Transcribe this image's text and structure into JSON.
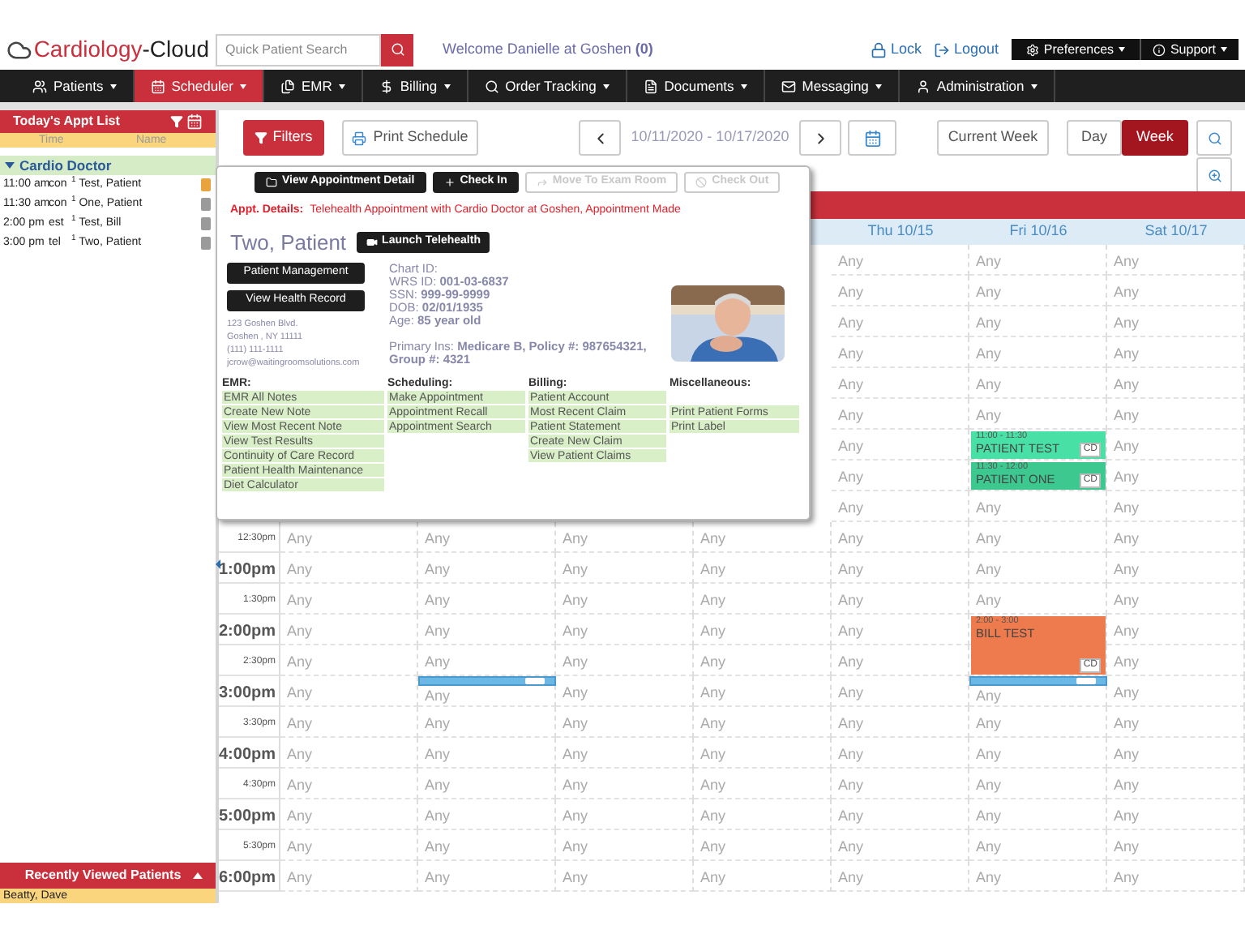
{
  "header": {
    "logo": {
      "brand": "Cardiology",
      "suffix": "-Cloud"
    },
    "search": {
      "placeholder": "Quick Patient Search"
    },
    "welcome": "Welcome Danielle at Goshen **(0)**",
    "links": [
      "Lock",
      "Logout"
    ],
    "menus": [
      "Preferences",
      "Support"
    ]
  },
  "nav": [
    {
      "label": "Patients",
      "selected": false
    },
    {
      "label": "Scheduler",
      "selected": true
    },
    {
      "label": "EMR",
      "selected": false
    },
    {
      "label": "Billing",
      "selected": false
    },
    {
      "label": "Order Tracking",
      "selected": false
    },
    {
      "label": "Documents",
      "selected": false
    },
    {
      "label": "Messaging",
      "selected": false
    },
    {
      "label": "Administration",
      "selected": false
    }
  ],
  "appt_list": {
    "title": "Today's Appt List",
    "columns": [
      "Time",
      "Name"
    ],
    "group": "Cardio Doctor",
    "expanded": true,
    "rows": [
      {
        "time": "11:00 am",
        "type": "con",
        "name": "$^{1}$ Test, Patient",
        "color": "#e8a33c"
      },
      {
        "time": "11:30 am",
        "type": "con",
        "name": "$^{1}$ One, Patient",
        "color": "#9a9a9a"
      },
      {
        "time": "2:00 pm",
        "type": "est",
        "name": "$^{1}$ Test, Bill",
        "color": "#9a9a9a"
      },
      {
        "time": "3:00 pm",
        "type": "tel",
        "name": "$^{1}$ Two, Patient",
        "color": "#9a9a9a"
      }
    ]
  },
  "recent": {
    "title": "Recently Viewed Patients",
    "items": [
      "Beatty, Dave"
    ]
  },
  "toolbar": {
    "filters": "Filters",
    "print": "Print Schedule",
    "range": "10/11/2020 - 10/17/2020",
    "current": "Current Week",
    "views": [
      {
        "label": "Day",
        "selected": false
      },
      {
        "label": "Week",
        "selected": true
      }
    ]
  },
  "calendar": {
    "days": [
      "Thu 10/15",
      "Fri 10/16",
      "Sat 10/17"
    ],
    "rows": [
      {
        "cells": [
          {
            "kind": "slot",
            "text": "Any"
          },
          {
            "kind": "slot",
            "text": "Any"
          },
          {
            "kind": "slot",
            "text": "Any"
          }
        ]
      },
      {
        "cells": [
          {
            "kind": "slot",
            "text": "Any"
          },
          {
            "kind": "slot",
            "text": "Any"
          },
          {
            "kind": "slot",
            "text": "Any"
          }
        ]
      },
      {
        "cells": [
          {
            "kind": "slot",
            "text": "Any"
          },
          {
            "kind": "slot",
            "text": "Any"
          },
          {
            "kind": "slot",
            "text": "Any"
          }
        ]
      },
      {
        "cells": [
          {
            "kind": "slot",
            "text": "Any"
          },
          {
            "kind": "slot",
            "text": "Any"
          },
          {
            "kind": "slot",
            "text": "Any"
          }
        ]
      },
      {
        "cells": [
          {
            "kind": "slot",
            "text": "Any"
          },
          {
            "kind": "slot",
            "text": "Any"
          },
          {
            "kind": "slot",
            "text": "Any"
          }
        ]
      },
      {
        "cells": [
          {
            "kind": "slot",
            "text": "Any"
          },
          {
            "kind": "slot",
            "text": "Any"
          },
          {
            "kind": "slot",
            "text": "Any"
          }
        ]
      },
      {
        "cells": [
          {
            "kind": "slot",
            "text": "Any"
          },
          {
            "kind": "event",
            "time": "11:00 - 11:30",
            "title": "PATIENT TEST",
            "badge": "CD",
            "color": "#48e0a4"
          },
          {
            "kind": "slot",
            "text": "Any"
          }
        ]
      },
      {
        "cells": [
          {
            "kind": "slot",
            "text": "Any"
          },
          {
            "kind": "event",
            "time": "11:30 - 12:00",
            "title": "PATIENT ONE",
            "badge": "CD",
            "color": "#3cc88e"
          },
          {
            "kind": "slot",
            "text": "Any"
          }
        ]
      },
      {
        "cells": [
          {
            "kind": "slot",
            "text": "Any"
          },
          {
            "kind": "slot",
            "text": "Any"
          },
          {
            "kind": "slot",
            "text": "Any"
          }
        ]
      },
      {
        "time": "12:30pm",
        "kind": "half",
        "cells": [
          {
            "kind": "slot",
            "text": "Any"
          },
          {
            "kind": "slot",
            "text": "Any"
          },
          {
            "kind": "slot",
            "text": "Any"
          },
          {
            "kind": "slot",
            "text": "Any"
          },
          {
            "kind": "slot",
            "text": "Any"
          },
          {
            "kind": "slot",
            "text": "Any"
          },
          {
            "kind": "slot",
            "text": "Any"
          }
        ]
      },
      {
        "time": "1:00pm",
        "kind": "hour",
        "cells": [
          {
            "kind": "slot",
            "text": "Any"
          },
          {
            "kind": "slot",
            "text": "Any"
          },
          {
            "kind": "slot",
            "text": "Any"
          },
          {
            "kind": "slot",
            "text": "Any"
          },
          {
            "kind": "slot",
            "text": "Any"
          },
          {
            "kind": "slot",
            "text": "Any"
          },
          {
            "kind": "slot",
            "text": "Any"
          }
        ]
      },
      {
        "time": "1:30pm",
        "kind": "half",
        "cells": [
          {
            "kind": "slot",
            "text": "Any"
          },
          {
            "kind": "slot",
            "text": "Any"
          },
          {
            "kind": "slot",
            "text": "Any"
          },
          {
            "kind": "slot",
            "text": "Any"
          },
          {
            "kind": "slot",
            "text": "Any"
          },
          {
            "kind": "slot",
            "text": "Any"
          },
          {
            "kind": "slot",
            "text": "Any"
          }
        ]
      },
      {
        "time": "2:00pm",
        "kind": "hour",
        "cells": [
          {
            "kind": "slot",
            "text": "Any"
          },
          {
            "kind": "slot",
            "text": "Any"
          },
          {
            "kind": "slot",
            "text": "Any"
          },
          {
            "kind": "slot",
            "text": "Any"
          },
          {
            "kind": "slot",
            "text": "Any"
          },
          {
            "kind": "event_start",
            "time": "2:00 - 3:00",
            "title": "BILL TEST",
            "color": "#ee7b4d"
          },
          {
            "kind": "slot",
            "text": "Any"
          }
        ]
      },
      {
        "time": "2:30pm",
        "kind": "half",
        "cells": [
          {
            "kind": "slot",
            "text": "Any"
          },
          {
            "kind": "slot",
            "text": "Any"
          },
          {
            "kind": "slot",
            "text": "Any"
          },
          {
            "kind": "slot",
            "text": "Any"
          },
          {
            "kind": "slot",
            "text": "Any"
          },
          {
            "kind": "event_end",
            "badge": "CD",
            "color": "#ee7b4d"
          },
          {
            "kind": "slot",
            "text": "Any"
          }
        ]
      },
      {
        "time": "3:00pm",
        "kind": "hour",
        "cells": [
          {
            "kind": "slot",
            "text": "Any"
          },
          {
            "kind": "slot_bar",
            "text": "Any"
          },
          {
            "kind": "slot",
            "text": "Any"
          },
          {
            "kind": "slot",
            "text": "Any"
          },
          {
            "kind": "slot",
            "text": "Any"
          },
          {
            "kind": "slot_bar",
            "text": "Any"
          },
          {
            "kind": "slot",
            "text": "Any"
          }
        ]
      },
      {
        "time": "3:30pm",
        "kind": "half",
        "cells": [
          {
            "kind": "slot",
            "text": "Any"
          },
          {
            "kind": "slot",
            "text": "Any"
          },
          {
            "kind": "slot",
            "text": "Any"
          },
          {
            "kind": "slot",
            "text": "Any"
          },
          {
            "kind": "slot",
            "text": "Any"
          },
          {
            "kind": "slot",
            "text": "Any"
          },
          {
            "kind": "slot",
            "text": "Any"
          }
        ]
      },
      {
        "time": "4:00pm",
        "kind": "hour",
        "cells": [
          {
            "kind": "slot",
            "text": "Any"
          },
          {
            "kind": "slot",
            "text": "Any"
          },
          {
            "kind": "slot",
            "text": "Any"
          },
          {
            "kind": "slot",
            "text": "Any"
          },
          {
            "kind": "slot",
            "text": "Any"
          },
          {
            "kind": "slot",
            "text": "Any"
          },
          {
            "kind": "slot",
            "text": "Any"
          }
        ]
      },
      {
        "time": "4:30pm",
        "kind": "half",
        "cells": [
          {
            "kind": "slot",
            "text": "Any"
          },
          {
            "kind": "slot",
            "text": "Any"
          },
          {
            "kind": "slot",
            "text": "Any"
          },
          {
            "kind": "slot",
            "text": "Any"
          },
          {
            "kind": "slot",
            "text": "Any"
          },
          {
            "kind": "slot",
            "text": "Any"
          },
          {
            "kind": "slot",
            "text": "Any"
          }
        ]
      },
      {
        "time": "5:00pm",
        "kind": "hour",
        "cells": [
          {
            "kind": "slot",
            "text": "Any"
          },
          {
            "kind": "slot",
            "text": "Any"
          },
          {
            "kind": "slot",
            "text": "Any"
          },
          {
            "kind": "slot",
            "text": "Any"
          },
          {
            "kind": "slot",
            "text": "Any"
          },
          {
            "kind": "slot",
            "text": "Any"
          },
          {
            "kind": "slot",
            "text": "Any"
          }
        ]
      },
      {
        "time": "5:30pm",
        "kind": "half",
        "cells": [
          {
            "kind": "slot",
            "text": "Any"
          },
          {
            "kind": "slot",
            "text": "Any"
          },
          {
            "kind": "slot",
            "text": "Any"
          },
          {
            "kind": "slot",
            "text": "Any"
          },
          {
            "kind": "slot",
            "text": "Any"
          },
          {
            "kind": "slot",
            "text": "Any"
          },
          {
            "kind": "slot",
            "text": "Any"
          }
        ]
      },
      {
        "time": "6:00pm",
        "kind": "hour",
        "cells": [
          {
            "kind": "slot",
            "text": "Any"
          },
          {
            "kind": "slot",
            "text": "Any"
          },
          {
            "kind": "slot",
            "text": "Any"
          },
          {
            "kind": "slot",
            "text": "Any"
          },
          {
            "kind": "slot",
            "text": "Any"
          },
          {
            "kind": "slot",
            "text": "Any"
          },
          {
            "kind": "slot",
            "text": "Any"
          }
        ]
      }
    ]
  },
  "popup": {
    "actions": [
      {
        "label": "View Appointment Detail",
        "disabled": false
      },
      {
        "label": "Check In",
        "disabled": false
      },
      {
        "label": "Move To Exam Room",
        "disabled": true
      },
      {
        "label": "Check Out",
        "disabled": true
      }
    ],
    "details_label": "Appt. Details:",
    "details": "Telehealth Appointment with Cardio Doctor at Goshen, Appointment Made",
    "patient": "Two, Patient",
    "telehealth": "Launch Telehealth",
    "buttons": [
      "Patient Management",
      "View Health Record"
    ],
    "address": [
      "123 Goshen Blvd.",
      "Goshen , NY 11111",
      "(111) 111-1111",
      "jcrow@waitingroomsolutions.com"
    ],
    "chart": [
      "Chart ID:",
      "WRS ID: **001-03-6837**",
      "SSN: **999-99-9999**",
      "DOB: **02/01/1935**",
      "Age: **85 year old**"
    ],
    "insurance": "Primary Ins: **Medicare B, Policy #: 987654321, Group #: 4321**",
    "menus": [
      {
        "title": "EMR:",
        "items": [
          "EMR All Notes",
          "Create New Note",
          "View Most Recent Note",
          "View Test Results",
          "Continuity of Care Record",
          "Patient Health Maintenance",
          "Diet Calculator"
        ]
      },
      {
        "title": "Scheduling:",
        "items": [
          "Make Appointment",
          "Appointment Recall",
          "Appointment Search"
        ]
      },
      {
        "title": "Billing:",
        "items": [
          "Patient Account",
          "Most Recent Claim",
          "Patient Statement",
          "Create New Claim",
          "View Patient Claims"
        ]
      },
      {
        "title": "Miscellaneous:",
        "items": [
          "Print Patient Forms",
          "Print Label"
        ]
      }
    ]
  }
}
